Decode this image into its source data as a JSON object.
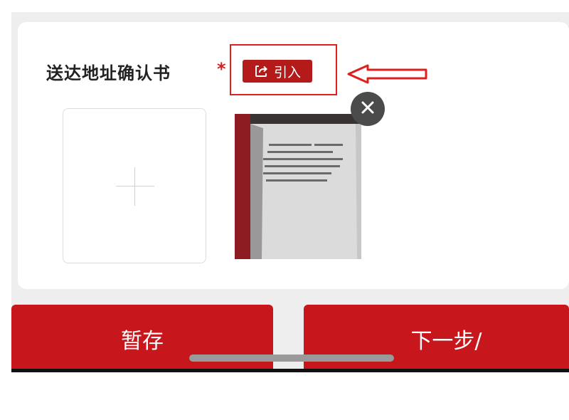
{
  "form": {
    "field_label": "送达地址确认书",
    "required_mark": "*",
    "import_button": {
      "label": "引入",
      "icon": "share-import-icon"
    },
    "upload": {
      "add_icon": "plus-icon",
      "remove_icon": "close-icon"
    }
  },
  "annotation": {
    "arrow_color": "#e0201f",
    "box_color": "#e0201f"
  },
  "actions": {
    "save_label": "暂存",
    "next_label": "下一步/"
  },
  "colors": {
    "primary": "#c8161d",
    "import_button_bg": "#b51a1a",
    "background": "#eeeeee",
    "card": "#ffffff"
  }
}
